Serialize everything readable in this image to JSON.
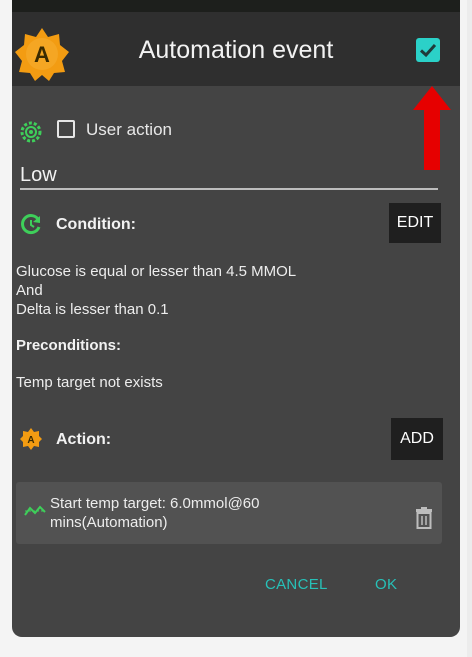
{
  "dialog": {
    "title": "Automation event",
    "app_icon_letter": "A",
    "confirm_checked": true
  },
  "user_action": {
    "label": "User action",
    "checked": false
  },
  "name_field": {
    "value": "Low"
  },
  "condition": {
    "label": "Condition:",
    "edit_label": "EDIT",
    "lines": [
      "Glucose is equal or lesser than 4.5 MMOL",
      "And",
      "Delta is lesser than 0.1"
    ]
  },
  "preconditions": {
    "label": "Preconditions:",
    "text": "Temp target not exists"
  },
  "action": {
    "label": "Action:",
    "add_label": "ADD",
    "icon_letter": "A",
    "items": [
      {
        "line1": "Start temp target: 6.0mmol@60",
        "line2": "mins(Automation)"
      }
    ]
  },
  "buttons": {
    "cancel": "CANCEL",
    "ok": "OK"
  },
  "colors": {
    "accent": "#2bd1c8",
    "dialog_bg": "#444444",
    "header_bg": "#2f2f2f",
    "logo_orange": "#f39c12",
    "condition_green": "#3ecf5a",
    "arrow_red": "#e60000"
  }
}
